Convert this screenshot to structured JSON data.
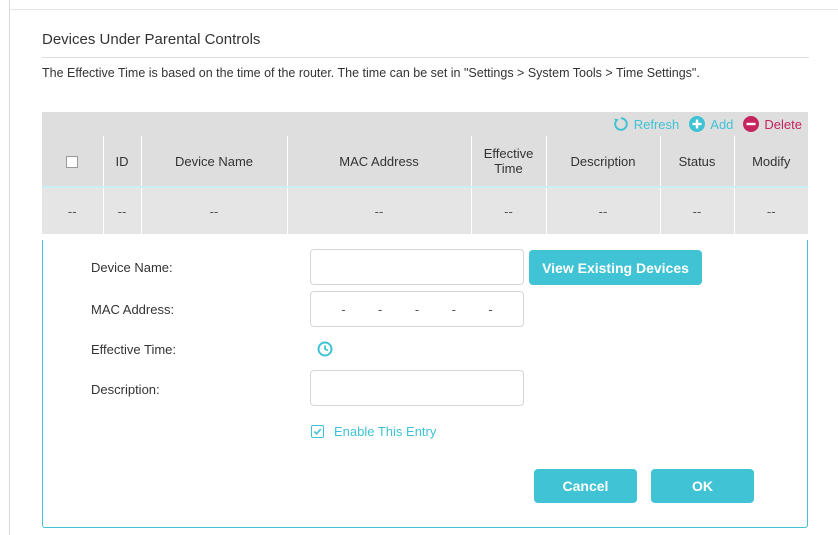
{
  "section": {
    "title": "Devices Under Parental Controls",
    "note": "The Effective Time is based on the time of the router. The time can be set in \"Settings > System Tools > Time Settings\"."
  },
  "toolbar": {
    "refresh_label": "Refresh",
    "add_label": "Add",
    "delete_label": "Delete",
    "refresh_icon": "refresh-icon",
    "add_icon": "plus-circle-icon",
    "delete_icon": "minus-circle-icon"
  },
  "table": {
    "headers": [
      "",
      "ID",
      "Device Name",
      "MAC Address",
      "Effective Time",
      "Description",
      "Status",
      "Modify"
    ],
    "rows": [
      [
        "--",
        "--",
        "--",
        "--",
        "--",
        "--",
        "--",
        "--"
      ]
    ]
  },
  "form": {
    "device_name_label": "Device Name:",
    "device_name_value": "",
    "view_existing_label": "View Existing Devices",
    "mac_label": "MAC Address:",
    "mac_separators": [
      "-",
      "-",
      "-",
      "-",
      "-"
    ],
    "effective_time_label": "Effective Time:",
    "effective_time_icon": "clock-icon",
    "description_label": "Description:",
    "description_value": "",
    "enable_label": "Enable This Entry",
    "enable_checked": true,
    "cancel_label": "Cancel",
    "ok_label": "OK"
  },
  "colors": {
    "accent": "#40c4d5",
    "delete": "#c5245f",
    "header_bg": "#dedede"
  }
}
